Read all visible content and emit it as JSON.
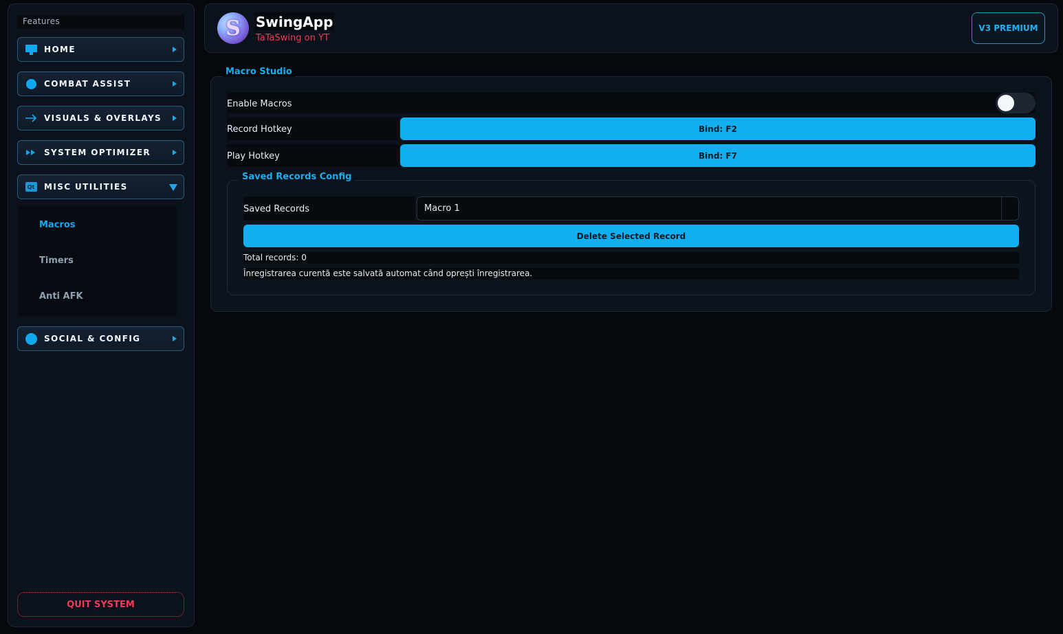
{
  "sidebar": {
    "features_label": "Features",
    "items": [
      {
        "label": "HOME",
        "icon": "monitor-icon"
      },
      {
        "label": "COMBAT ASSIST",
        "icon": "circle-icon"
      },
      {
        "label": "VISUALS & OVERLAYS",
        "icon": "arrow-right-icon"
      },
      {
        "label": "SYSTEM OPTIMIZER",
        "icon": "fast-forward-icon"
      },
      {
        "label": "MISC UTILITIES",
        "icon": "qt-icon",
        "expanded": true
      },
      {
        "label": "SOCIAL & CONFIG",
        "icon": "circle-icon"
      }
    ],
    "submenu": [
      {
        "label": "Macros",
        "active": true
      },
      {
        "label": "Timers",
        "active": false
      },
      {
        "label": "Anti AFK",
        "active": false
      }
    ],
    "quit_label": "QUIT SYSTEM"
  },
  "header": {
    "logo_letter": "S",
    "title": "SwingApp",
    "subtitle": "TaTaSwing on YT",
    "badge": "V3 PREMIUM"
  },
  "macro_studio": {
    "title": "Macro Studio",
    "enable_label": "Enable Macros",
    "enable_state": false,
    "record_label": "Record Hotkey",
    "record_bind": "Bind: F2",
    "play_label": "Play Hotkey",
    "play_bind": "Bind: F7"
  },
  "saved_records": {
    "title": "Saved Records Config",
    "label": "Saved Records",
    "selected": "Macro 1",
    "delete_label": "Delete Selected Record",
    "total": "Total records: 0",
    "note": "Înregistrarea curentă este salvată automat când oprești înregistrarea."
  },
  "colors": {
    "accent": "#10b0f0",
    "danger": "#ef3b59",
    "background": "#05080d",
    "panel": "#0b121b"
  }
}
